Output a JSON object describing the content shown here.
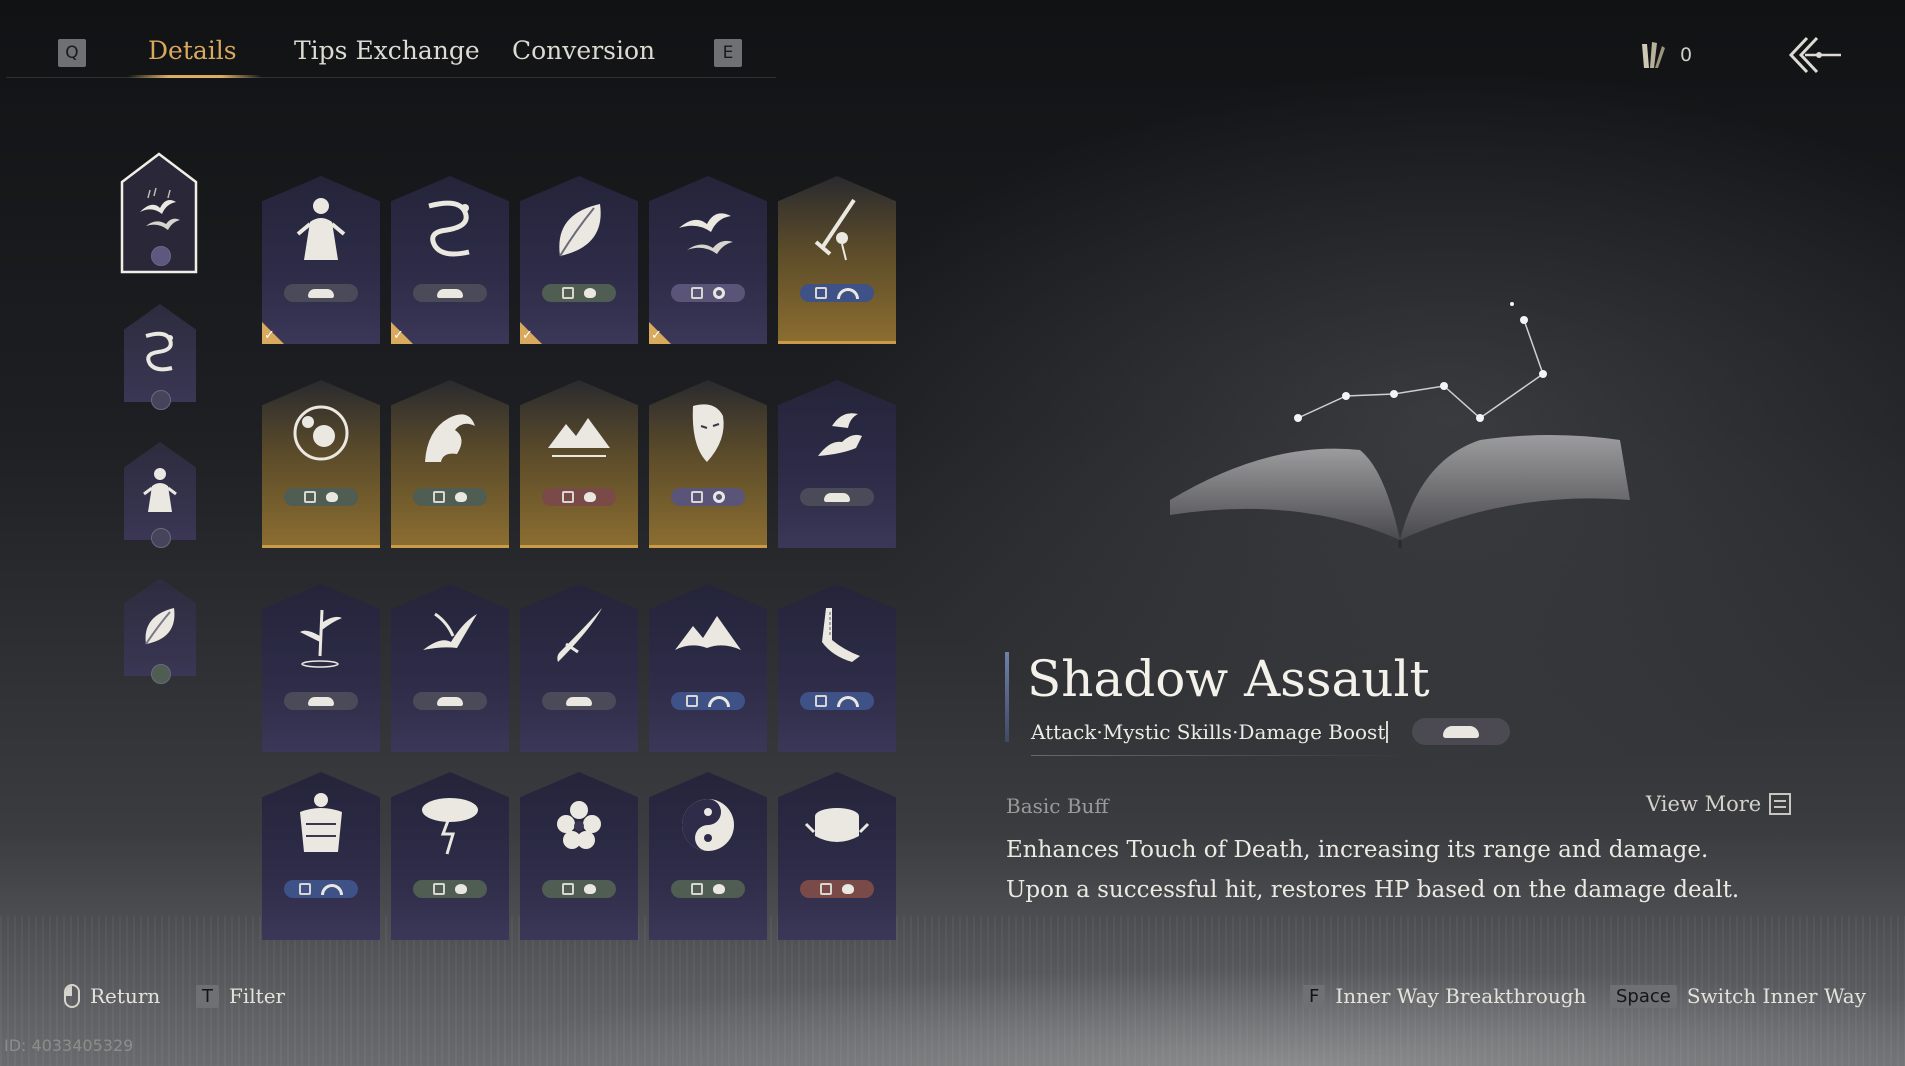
{
  "nav": {
    "prev_key": "Q",
    "next_key": "E",
    "tabs": [
      "Details",
      "Tips Exchange",
      "Conversion"
    ],
    "active_tab": "Details"
  },
  "currency": {
    "icon": "reed-token-icon",
    "count": "0"
  },
  "back": {
    "icon": "back-arrow-icon"
  },
  "sidebar": {
    "items": [
      {
        "glyph": "swallows-icon",
        "selected": true
      },
      {
        "glyph": "dragon-icon",
        "selected": false
      },
      {
        "glyph": "figure-icon",
        "selected": false
      },
      {
        "glyph": "leaf-icon",
        "selected": false
      }
    ]
  },
  "grid": {
    "rows": [
      [
        {
          "glyph": "figure-icon",
          "tag": "neutral",
          "equipped": true,
          "gold": false
        },
        {
          "glyph": "dragon-icon",
          "tag": "neutral",
          "equipped": true,
          "gold": false
        },
        {
          "glyph": "leaf-icon",
          "tag": "green",
          "equipped": true,
          "gold": false
        },
        {
          "glyph": "swallows-icon",
          "tag": "purple",
          "equipped": true,
          "gold": false
        },
        {
          "glyph": "sword-icon",
          "tag": "blue",
          "equipped": false,
          "gold": true
        }
      ],
      [
        {
          "glyph": "flower-circle-icon",
          "tag": "green",
          "equipped": false,
          "gold": true
        },
        {
          "glyph": "wave-icon",
          "tag": "green",
          "equipped": false,
          "gold": true
        },
        {
          "glyph": "mountain-icon",
          "tag": "red",
          "equipped": false,
          "gold": true
        },
        {
          "glyph": "mask-icon",
          "tag": "purple",
          "equipped": false,
          "gold": true
        },
        {
          "glyph": "bird-hand-icon",
          "tag": "neutral",
          "equipped": false,
          "gold": false
        }
      ],
      [
        {
          "glyph": "bamboo-icon",
          "tag": "neutral",
          "equipped": false,
          "gold": false
        },
        {
          "glyph": "swallow-icon",
          "tag": "neutral",
          "equipped": false,
          "gold": false
        },
        {
          "glyph": "blade-icon",
          "tag": "neutral",
          "equipped": false,
          "gold": false
        },
        {
          "glyph": "peaks-icon",
          "tag": "blue",
          "equipped": false,
          "gold": false
        },
        {
          "glyph": "prayer-hands-icon",
          "tag": "blue",
          "equipped": false,
          "gold": false
        }
      ],
      [
        {
          "glyph": "armor-icon",
          "tag": "blue",
          "equipped": false,
          "gold": false
        },
        {
          "glyph": "storm-tree-icon",
          "tag": "green",
          "equipped": false,
          "gold": false
        },
        {
          "glyph": "blossom-icon",
          "tag": "green",
          "equipped": false,
          "gold": false
        },
        {
          "glyph": "yin-yang-icon",
          "tag": "green",
          "equipped": false,
          "gold": false
        },
        {
          "glyph": "drum-icon",
          "tag": "red",
          "equipped": false,
          "gold": false
        }
      ]
    ]
  },
  "detail": {
    "title": "Shadow Assault",
    "subtitle": "Attack·Mystic Skills·Damage Boost",
    "section_label": "Basic Buff",
    "view_more": "View More",
    "description": "Enhances Touch of Death, increasing its range and damage. Upon a successful hit, restores HP based on the damage dealt."
  },
  "footer": {
    "return_label": "Return",
    "filter_key": "T",
    "filter_label": "Filter",
    "breakthrough_key": "F",
    "breakthrough_label": "Inner Way Breakthrough",
    "switch_key": "Space",
    "switch_label": "Switch Inner Way",
    "uid": "ID: 4033405329"
  },
  "colors": {
    "accent_gold": "#d9a95e",
    "card_purple": "#2e2c48",
    "tag_blue": "#3e5287",
    "tag_green": "#4f5d53",
    "tag_red": "#7a4a48"
  }
}
